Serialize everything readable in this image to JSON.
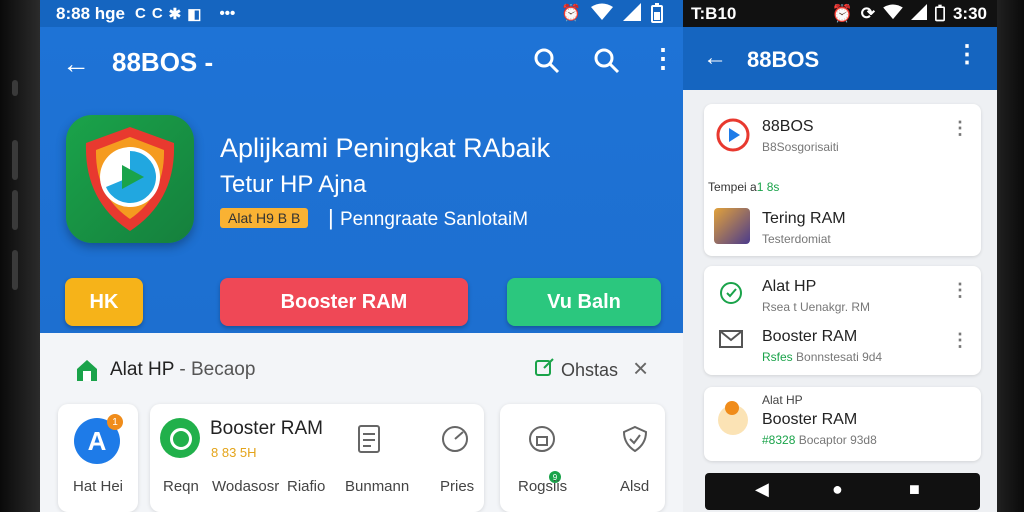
{
  "left": {
    "status": {
      "time": "8:88 hge",
      "icons": [
        "C",
        "C",
        "✱",
        "◧",
        "•••"
      ]
    },
    "appbar": {
      "title": "88BOS -"
    },
    "app": {
      "title": "Aplijkami Peningkat RAbaik",
      "subtitle": "Tetur HP Ajna",
      "chip": "Alat H9 B B",
      "separator": "|",
      "description": "Penngraate SanlotaiM"
    },
    "buttons": {
      "hk": "HK",
      "booster": "Booster RAM",
      "vu": "Vu Baln"
    },
    "panel": {
      "title": "Alat HP",
      "title_sub": " - Becaop",
      "action": "Ohstas",
      "close": "×"
    },
    "cards": {
      "card1_icon_letter": "A",
      "card1_badge": "1",
      "card1_label": "Hat Hei",
      "app_name": "Booster RAM",
      "app_meta": "8 83 5H",
      "labels": [
        "Reqn",
        "Wodasosr",
        "Riafio",
        "Bunmann",
        "Pries",
        "Rogsiis",
        "Alsd"
      ],
      "rogs_badge": "9"
    }
  },
  "right": {
    "status": {
      "time": "T:B10",
      "right_time": "3:30"
    },
    "appbar": {
      "title": "88BOS"
    },
    "card1": {
      "app_name": "88BOS",
      "app_sub": "B8Sosgorisaiti",
      "section": "Tempei a",
      "section_badge": "1 8s",
      "item_title": "Tering RAM",
      "item_sub": "Testerdomiat"
    },
    "card2": {
      "row1_title": "Alat HP",
      "row1_sub": "Rsea t Uenakgr. RM",
      "row2_title": "Booster RAM",
      "row2_sub_green": "Rsfes",
      "row2_sub": " Bonnstesati 9d4"
    },
    "card3": {
      "line1": "Alat HP",
      "line2": "Booster RAM",
      "line3_green": "#8328",
      "line3": " Bocaptor 93d8"
    },
    "nav": {
      "back": "◀",
      "home": "●",
      "recent": "■"
    }
  },
  "colors": {
    "primary": "#1565c0",
    "hero": "#1e73d6",
    "orange": "#f6b319",
    "red": "#ef4856",
    "green": "#2bc77e"
  }
}
